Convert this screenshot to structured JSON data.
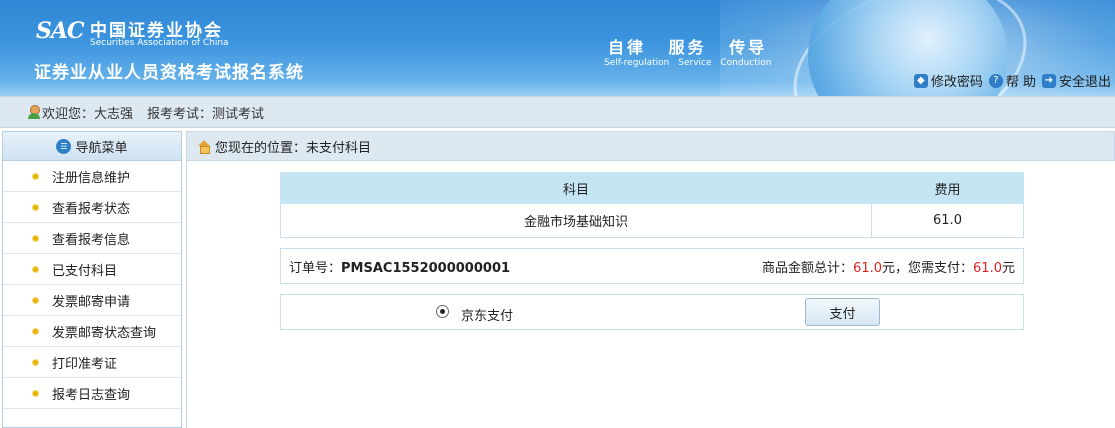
{
  "header": {
    "logo_mark": "SAC",
    "logo_cn": "中国证券业协会",
    "logo_en": "Securities Association of China",
    "system_title": "证券业从业人员资格考试报名系统",
    "slogan_cn": "自律 服务 传导",
    "slogan_en": "Self-regulation Service Conduction",
    "links": {
      "change_password": "修改密码",
      "help": "帮 助",
      "logout": "安全退出"
    },
    "icons": [
      "lock-icon",
      "help-icon",
      "logout-icon"
    ]
  },
  "welcome": {
    "greeting": "欢迎您：大志强",
    "exam": "报考考试：测试考试"
  },
  "sidebar": {
    "title": "导航菜单",
    "items": [
      {
        "label": "注册信息维护"
      },
      {
        "label": "查看报考状态"
      },
      {
        "label": "查看报考信息"
      },
      {
        "label": "已支付科目"
      },
      {
        "label": "发票邮寄申请"
      },
      {
        "label": "发票邮寄状态查询"
      },
      {
        "label": "打印准考证"
      },
      {
        "label": "报考日志查询"
      }
    ]
  },
  "location": {
    "text": "您现在的位置：未支付科目"
  },
  "table": {
    "headers": [
      "科目",
      "费用"
    ],
    "rows": [
      [
        "金融市场基础知识",
        "61.0"
      ]
    ]
  },
  "order": {
    "label": "订单号：",
    "number": "PMSAC1552000000001",
    "total_label": "商品金额总计：",
    "total_value": "61.0",
    "unit1": "元，您需支付：",
    "pay_value": "61.0",
    "unit2": "元"
  },
  "payment": {
    "option_label": "京东支付",
    "button_label": "支付"
  },
  "colors": {
    "banner": "#3d95de",
    "amount_red": "#dd2222",
    "table_header": "#c5e4f4"
  }
}
